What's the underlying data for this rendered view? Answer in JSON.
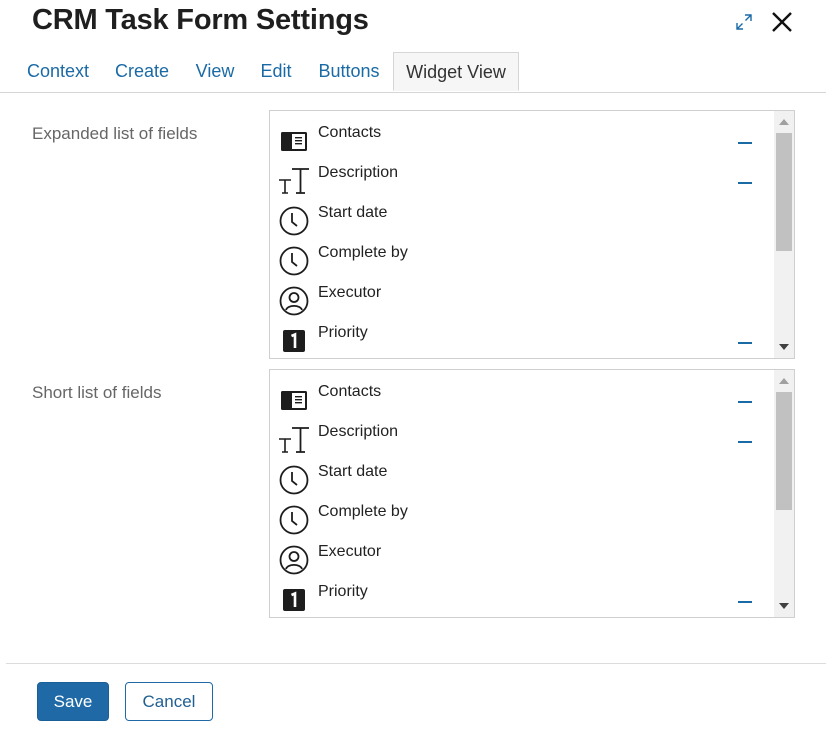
{
  "dialog": {
    "title": "CRM Task Form Settings"
  },
  "tabs": [
    {
      "label": "Context"
    },
    {
      "label": "Create"
    },
    {
      "label": "View"
    },
    {
      "label": "Edit"
    },
    {
      "label": "Buttons"
    },
    {
      "label": "Widget View",
      "active": true
    }
  ],
  "expanded": {
    "label": "Expanded list of fields",
    "fields": [
      {
        "label": "Contacts",
        "icon": "contact-card-icon",
        "removable": true
      },
      {
        "label": "Description",
        "icon": "text-icon",
        "removable": true
      },
      {
        "label": "Start date",
        "icon": "clock-icon",
        "removable": false
      },
      {
        "label": "Complete by",
        "icon": "clock-icon",
        "removable": false
      },
      {
        "label": "Executor",
        "icon": "user-icon",
        "removable": false
      },
      {
        "label": "Priority",
        "icon": "number-one-icon",
        "removable": true
      }
    ]
  },
  "short": {
    "label": "Short list of fields",
    "fields": [
      {
        "label": "Contacts",
        "icon": "contact-card-icon",
        "removable": true
      },
      {
        "label": "Description",
        "icon": "text-icon",
        "removable": true
      },
      {
        "label": "Start date",
        "icon": "clock-icon",
        "removable": false
      },
      {
        "label": "Complete by",
        "icon": "clock-icon",
        "removable": false
      },
      {
        "label": "Executor",
        "icon": "user-icon",
        "removable": false
      },
      {
        "label": "Priority",
        "icon": "number-one-icon",
        "removable": true
      }
    ]
  },
  "footer": {
    "save_label": "Save",
    "cancel_label": "Cancel"
  },
  "colors": {
    "accent": "#1f6aa6",
    "link": "#1a6aa6"
  }
}
